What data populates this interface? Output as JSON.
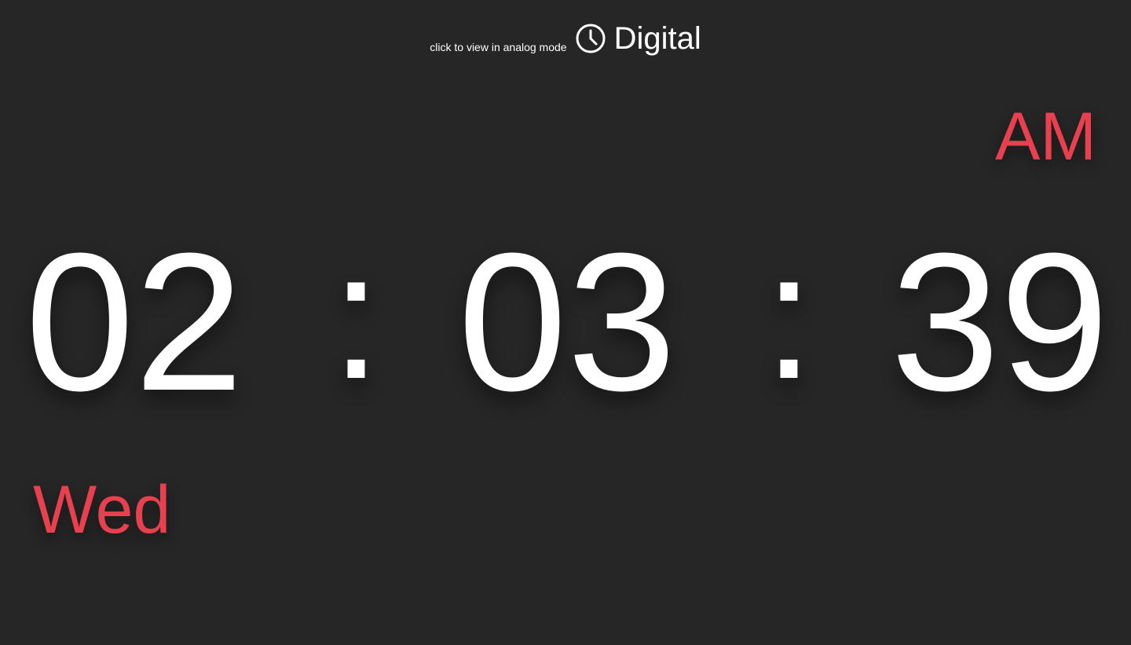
{
  "header": {
    "hint": "click to view in analog mode",
    "mode_label": "Digital",
    "icon": "clock-icon"
  },
  "clock": {
    "hour": "02",
    "minute": "03",
    "second": "39",
    "separator": ":",
    "ampm": "AM",
    "day": "Wed"
  },
  "colors": {
    "background": "#262626",
    "accent": "#e8404f",
    "text": "#ffffff"
  }
}
